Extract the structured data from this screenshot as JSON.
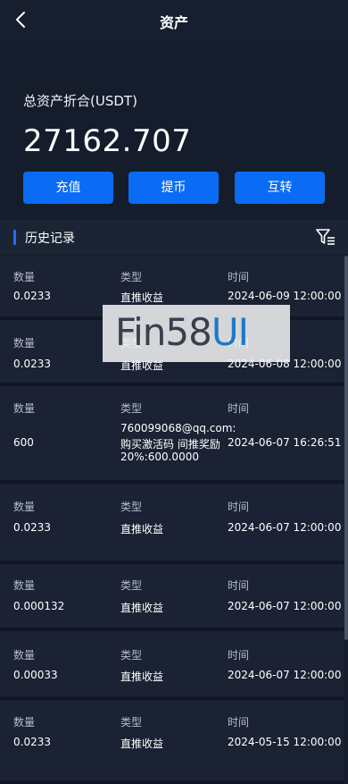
{
  "header": {
    "title": "资产"
  },
  "summary": {
    "label": "总资产折合(USDT)",
    "value": "27162.707"
  },
  "actions": {
    "deposit": "充值",
    "withdraw": "提币",
    "transfer": "互转"
  },
  "history": {
    "title": "历史记录"
  },
  "columns": {
    "amount": "数量",
    "type": "类型",
    "time": "时间"
  },
  "records": [
    {
      "amount": "0.0233",
      "type": "直推收益",
      "time": "2024-06-09 12:00:00"
    },
    {
      "amount": "0.0233",
      "type": "直推收益",
      "time": "2024-06-08 12:00:00"
    },
    {
      "amount": "600",
      "type_lines": [
        "760099068@qq.com:",
        "购买激活码 间推奖励",
        "20%:600.0000"
      ],
      "time": "2024-06-07 16:26:51"
    },
    {
      "amount": "0.0233",
      "type": "直推收益",
      "time": "2024-06-07 12:00:00"
    },
    {
      "amount": "0.000132",
      "type": "直推收益",
      "time": "2024-06-07 12:00:00"
    },
    {
      "amount": "0.00033",
      "type": "直推收益",
      "time": "2024-06-07 12:00:00"
    },
    {
      "amount": "0.0233",
      "type": "直推收益",
      "time": "2024-05-15 12:00:00"
    }
  ],
  "watermark": {
    "part1": "Fin58",
    "part2": "UI"
  },
  "icons": {
    "back": "chevron-left-icon",
    "filter": "filter-list-icon"
  },
  "colors": {
    "accent": "#0a6cf5",
    "background": "#151d2c",
    "card": "#1a2233"
  }
}
